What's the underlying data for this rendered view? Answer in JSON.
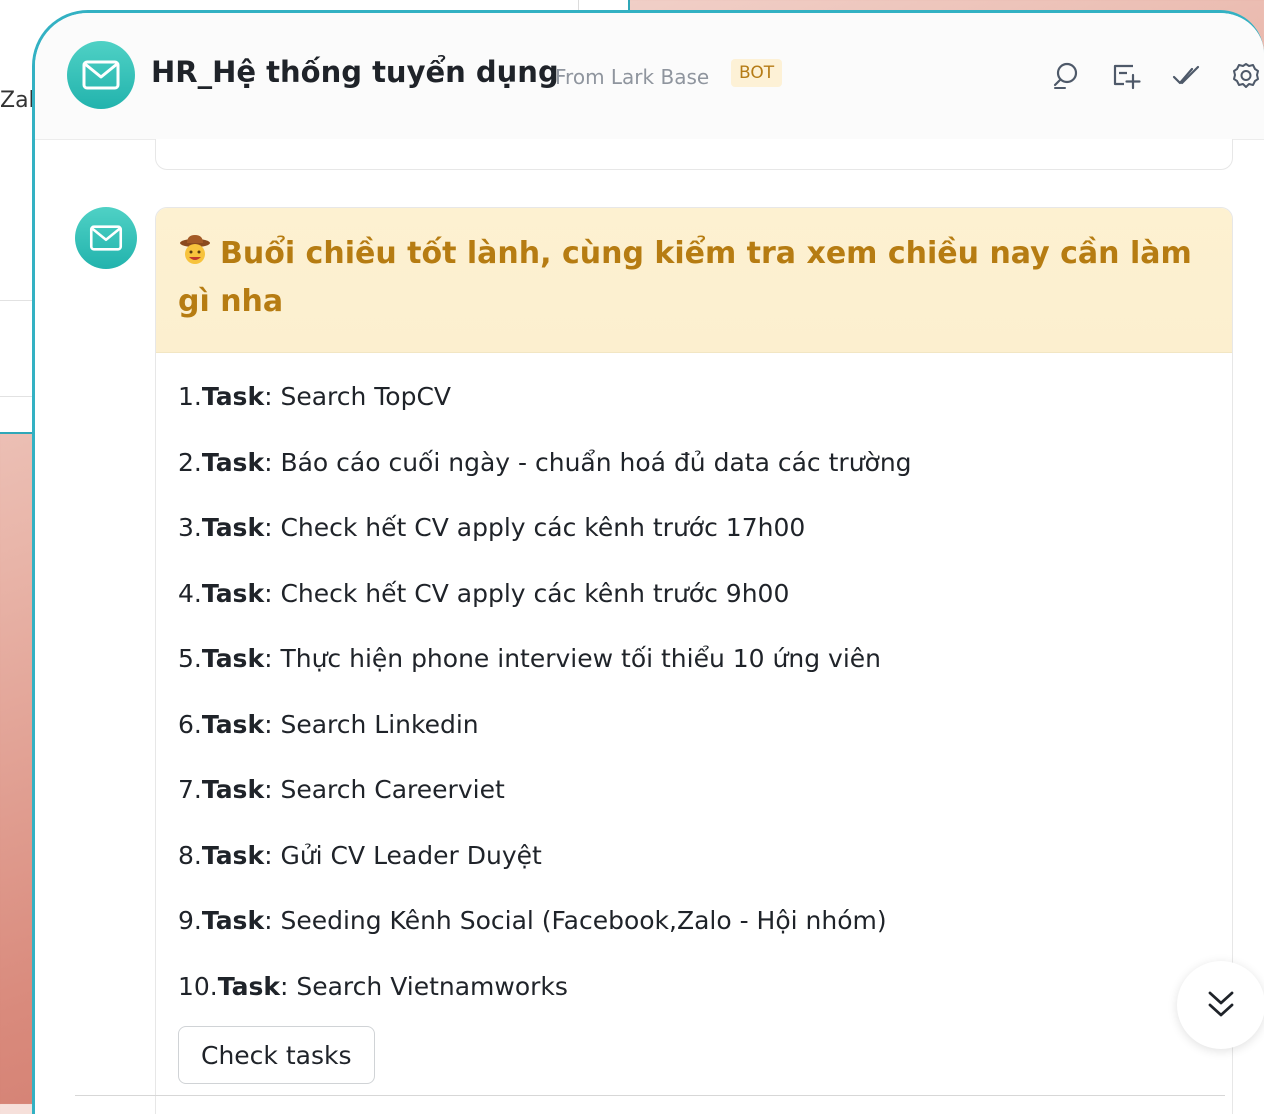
{
  "background_window": {
    "partial_text": "Zalc"
  },
  "header": {
    "title": "HR_Hệ thống tuyển dụng",
    "subtitle": "From Lark Base",
    "badge": "BOT",
    "icons": [
      "search-icon",
      "add-tab-icon",
      "checklist-icon",
      "settings-icon"
    ]
  },
  "message": {
    "title": "Buổi chiều tốt lành, cùng kiểm tra xem chiều nay cần làm gì nha",
    "emoji": "cowboy-face-emoji",
    "task_word": "Task",
    "tasks": [
      {
        "num": "1.",
        "text": ": Search TopCV"
      },
      {
        "num": "2.",
        "text": ": Báo cáo cuối ngày - chuẩn hoá đủ data các trường"
      },
      {
        "num": "3.",
        "text": ": Check hết CV apply các kênh trước 17h00"
      },
      {
        "num": "4.",
        "text": ": Check hết CV apply các kênh trước 9h00"
      },
      {
        "num": "5.",
        "text": ": Thực hiện phone interview tối thiểu 10 ứng viên"
      },
      {
        "num": "6.",
        "text": ": Search Linkedin"
      },
      {
        "num": "7.",
        "text": ": Search Careerviet"
      },
      {
        "num": "8.",
        "text": ": Gửi CV Leader Duyệt"
      },
      {
        "num": "9.",
        "text": ": Seeding Kênh Social (Facebook,Zalo - Hội nhóm)"
      },
      {
        "num": "10.",
        "text": ": Search Vietnamworks"
      }
    ],
    "button_label": "Check tasks"
  },
  "colors": {
    "accent_teal": "#33b1c3",
    "title_gold": "#b67c12",
    "card_header_bg": "#fdf1d1"
  }
}
